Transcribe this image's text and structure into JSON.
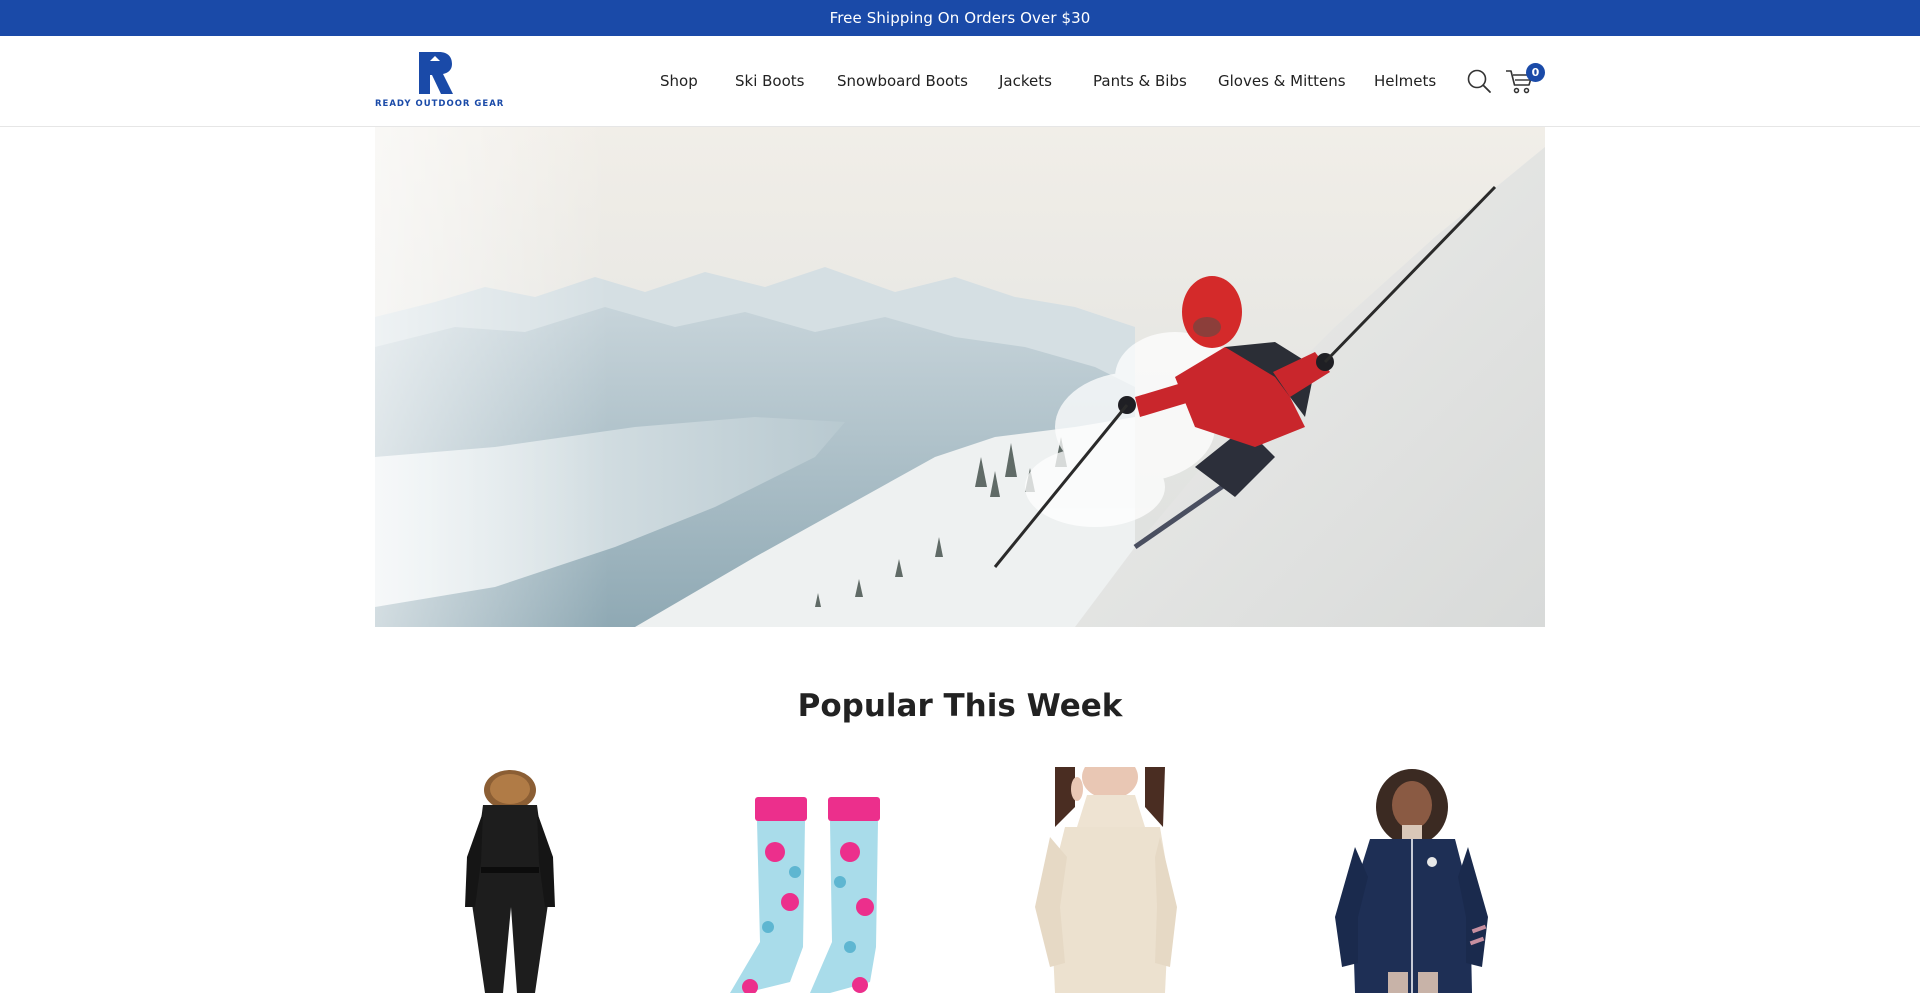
{
  "announcement": {
    "text": "Free Shipping On Orders Over $30"
  },
  "brand": {
    "logo_text": "READY OUTDOOR GEAR",
    "primary_color": "#1a4aa8"
  },
  "nav": {
    "items": [
      {
        "label": "Shop"
      },
      {
        "label": "Ski Boots"
      },
      {
        "label": "Snowboard Boots"
      },
      {
        "label": "Jackets"
      },
      {
        "label": "Pants & Bibs"
      },
      {
        "label": "Gloves & Mittens"
      },
      {
        "label": "Helmets"
      }
    ]
  },
  "header_icons": {
    "search": "search-icon",
    "cart": "cart-icon",
    "cart_count": "0"
  },
  "hero": {
    "image": "skier-on-snowy-slope-above-mountain-lake"
  },
  "popular": {
    "title": "Popular This Week",
    "products": [
      {
        "image": "black-one-piece-ski-suit-with-fur-hood"
      },
      {
        "image": "blue-pink-snowflake-ski-socks"
      },
      {
        "image": "cream-knit-turtleneck-sweater"
      },
      {
        "image": "navy-ski-jacket"
      }
    ]
  }
}
